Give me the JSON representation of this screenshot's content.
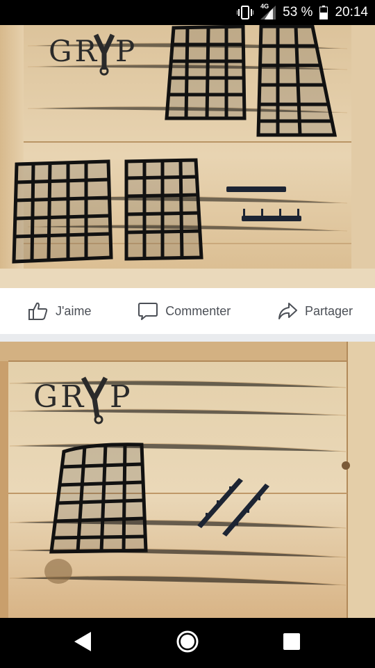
{
  "status_bar": {
    "network": "4G",
    "battery": "53 %",
    "time": "20:14"
  },
  "post_photo_1": {
    "logo_text": "GRYP"
  },
  "actions": {
    "like_label": "J'aime",
    "comment_label": "Commenter",
    "share_label": "Partager"
  },
  "post_photo_2": {
    "logo_text": "GRYP"
  },
  "colors": {
    "status_bar": "#000000",
    "action_text": "#4b4f56",
    "page_background": "#e9ebee"
  }
}
